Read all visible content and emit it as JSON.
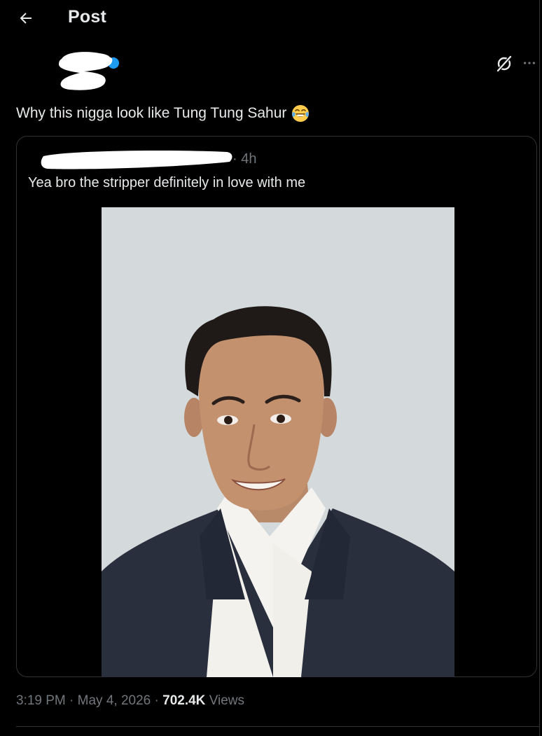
{
  "header": {
    "title": "Post",
    "back_icon": "arrow-left-icon"
  },
  "post": {
    "text": "Why this nigga look like Tung Tung Sahur",
    "emoji": "face-with-tears-of-joy",
    "actions": {
      "grok_icon": "grok-icon",
      "more_icon": "more-horizontal-icon"
    }
  },
  "quote": {
    "time": "· 4h",
    "text": "Yea bro the stripper definitely in love with me"
  },
  "meta": {
    "time": "3:19 PM",
    "sep1": "·",
    "date": "May 4, 2026",
    "sep2": "·",
    "views_count": "702.4K",
    "views_label": "Views"
  },
  "colors": {
    "background": "#000000",
    "text_primary": "#e7e9ea",
    "text_secondary": "#71767b",
    "border": "#2f3336",
    "verified_badge": "#1d9bf0"
  }
}
